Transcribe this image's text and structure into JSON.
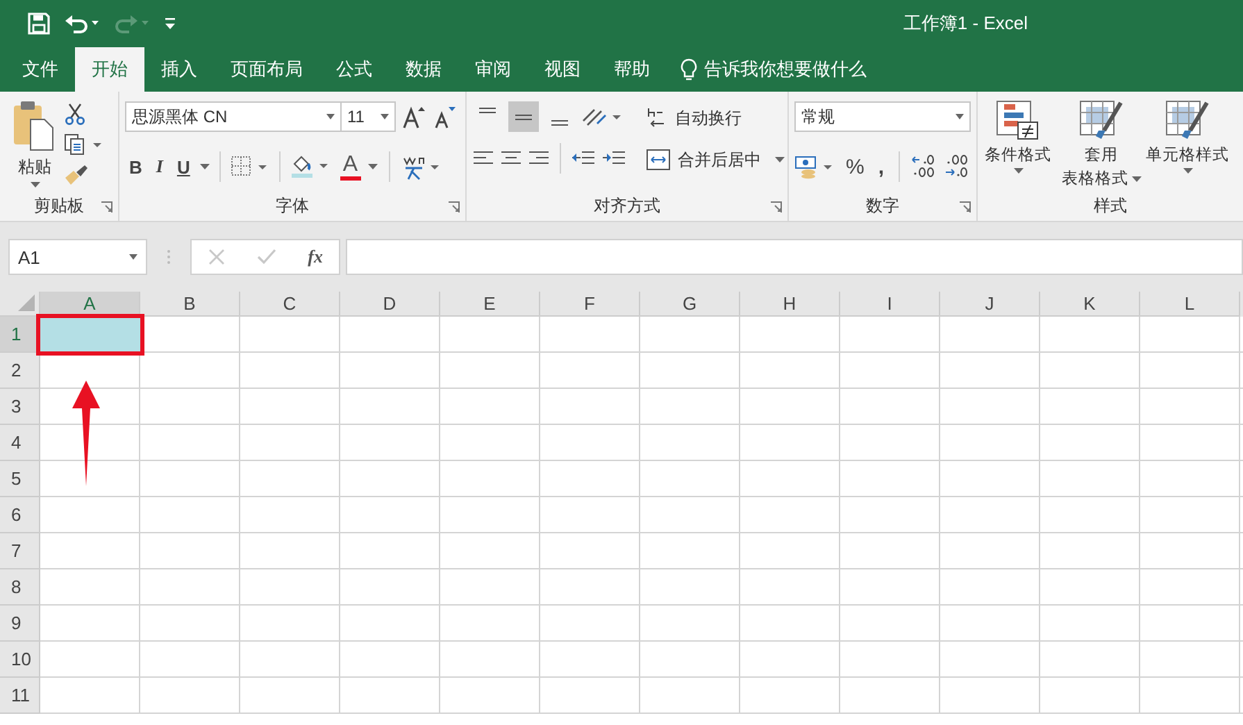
{
  "window": {
    "title": "工作簿1  -  Excel"
  },
  "tabs": [
    {
      "label": "文件",
      "selected": false
    },
    {
      "label": "开始",
      "selected": true
    },
    {
      "label": "插入",
      "selected": false
    },
    {
      "label": "页面布局",
      "selected": false
    },
    {
      "label": "公式",
      "selected": false
    },
    {
      "label": "数据",
      "selected": false
    },
    {
      "label": "审阅",
      "selected": false
    },
    {
      "label": "视图",
      "selected": false
    },
    {
      "label": "帮助",
      "selected": false
    }
  ],
  "tell_me": {
    "placeholder": "告诉我你想要做什么"
  },
  "ribbon": {
    "clipboard": {
      "paste": "粘贴",
      "label": "剪贴板"
    },
    "font": {
      "font_name": "思源黑体 CN",
      "font_size": "11",
      "bold": "B",
      "italic": "I",
      "underline": "U",
      "font_color_letter": "A",
      "label": "字体"
    },
    "alignment": {
      "vertical": [
        {
          "kind": "top",
          "selected": false
        },
        {
          "kind": "middle",
          "selected": true
        },
        {
          "kind": "bottom",
          "selected": false
        }
      ],
      "wrap": "自动换行",
      "merge": "合并后居中",
      "label": "对齐方式"
    },
    "number": {
      "format": "常规",
      "percent": "%",
      "comma": ",",
      "label": "数字"
    },
    "styles": {
      "buttons": [
        {
          "line1": "条件格式"
        },
        {
          "line1": "套用",
          "line2": "表格格式"
        },
        {
          "line1": "单元格样式"
        }
      ],
      "label": "样式"
    }
  },
  "formula_bar": {
    "name_box": "A1",
    "fx": "fx"
  },
  "sheet": {
    "columns": [
      {
        "label": "A",
        "selected": true
      },
      {
        "label": "B",
        "selected": false
      },
      {
        "label": "C",
        "selected": false
      },
      {
        "label": "D",
        "selected": false
      },
      {
        "label": "E",
        "selected": false
      },
      {
        "label": "F",
        "selected": false
      },
      {
        "label": "G",
        "selected": false
      },
      {
        "label": "H",
        "selected": false
      },
      {
        "label": "I",
        "selected": false
      },
      {
        "label": "J",
        "selected": false
      },
      {
        "label": "K",
        "selected": false
      },
      {
        "label": "L",
        "selected": false
      }
    ],
    "rows": [
      {
        "label": "1",
        "selected": true,
        "cells": [
          {
            "color": "#b4dfe5"
          }
        ]
      },
      {
        "label": "2",
        "selected": false
      },
      {
        "label": "3",
        "selected": false
      },
      {
        "label": "4",
        "selected": false
      },
      {
        "label": "5",
        "selected": false
      },
      {
        "label": "6",
        "selected": false
      },
      {
        "label": "7",
        "selected": false
      },
      {
        "label": "8",
        "selected": false
      },
      {
        "label": "9",
        "selected": false
      },
      {
        "label": "10",
        "selected": false
      },
      {
        "label": "11",
        "selected": false
      }
    ]
  }
}
